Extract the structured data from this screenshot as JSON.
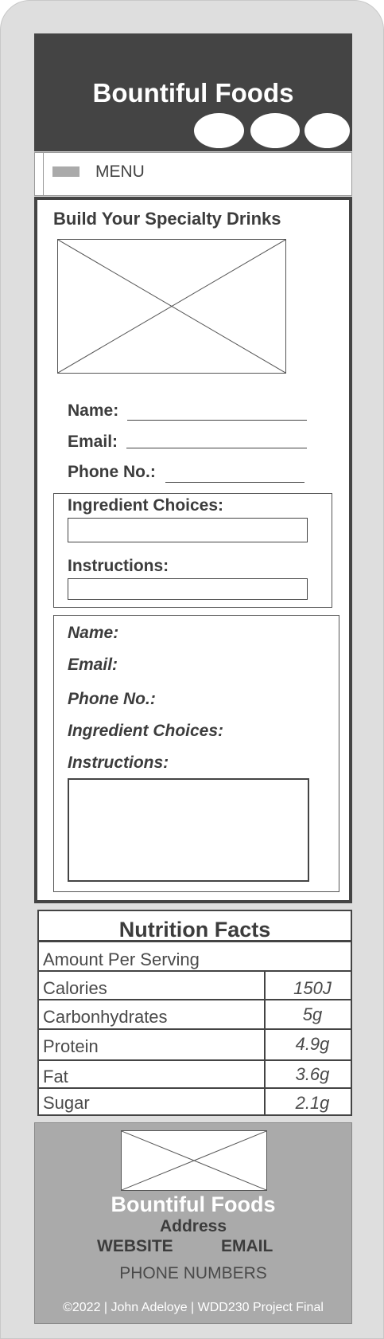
{
  "header": {
    "brand": "Bountiful Foods",
    "social_icons": [
      "social-icon-1",
      "social-icon-2",
      "social-icon-3"
    ]
  },
  "nav": {
    "menu_label": "MENU",
    "hamburger_icon": "hamburger-icon"
  },
  "drink_form": {
    "title": "Build Your Specialty Drinks",
    "fields": {
      "name_label": "Name:",
      "email_label": "Email:",
      "phone_label": "Phone No.:",
      "ingredients_label": "Ingredient Choices:",
      "instructions_label": "Instructions:"
    },
    "review": {
      "name_label": "Name:",
      "email_label": "Email:",
      "phone_label": "Phone No.:",
      "ingredients_label": "Ingredient Choices:",
      "instructions_label": "Instructions:"
    }
  },
  "nutrition": {
    "title": "Nutrition Facts",
    "serving_label": "Amount Per Serving",
    "rows": [
      {
        "label": "Calories",
        "value": "150J"
      },
      {
        "label": "Carbonhydrates",
        "value": "5g"
      },
      {
        "label": "Protein",
        "value": "4.9g"
      },
      {
        "label": "Fat",
        "value": "3.6g"
      },
      {
        "label": "Sugar",
        "value": "2.1g"
      }
    ]
  },
  "footer": {
    "brand": "Bountiful Foods",
    "address": "Address",
    "website": "WEBSITE",
    "email": "EMAIL",
    "phone": "PHONE NUMBERS",
    "copyright": "©2022 | John Adeloye | WDD230 Project Final"
  },
  "colors": {
    "header_bg": "#444444",
    "footer_bg": "#aaaaaa",
    "page_bg": "#dedede"
  }
}
